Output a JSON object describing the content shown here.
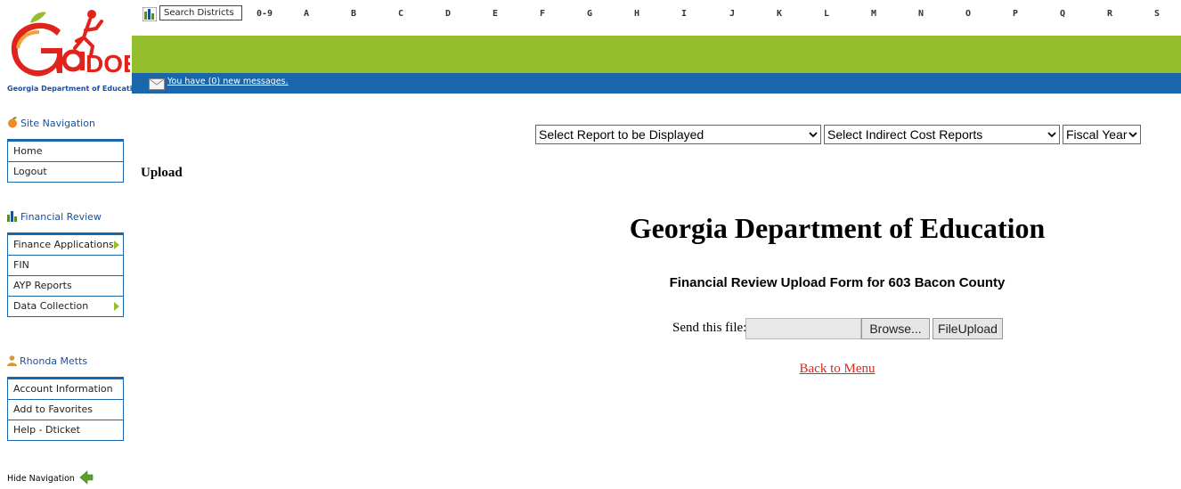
{
  "logo": {
    "caption": "Georgia Department of Education",
    "wordmark": "GaDOE",
    "colors": {
      "red": "#e0241c",
      "green": "#95be2f",
      "blue": "#1a4fa0"
    }
  },
  "topbar": {
    "search_placeholder": "Search Districts",
    "letters": [
      "0-9",
      "A",
      "B",
      "C",
      "D",
      "E",
      "F",
      "G",
      "H",
      "I",
      "J",
      "K",
      "L",
      "M",
      "N",
      "O",
      "P",
      "Q",
      "R",
      "S"
    ]
  },
  "messages": {
    "text": "You have (0) new messages."
  },
  "sidebar": {
    "site_nav": {
      "heading": "Site Navigation",
      "items": [
        {
          "label": "Home"
        },
        {
          "label": "Logout"
        }
      ]
    },
    "financial": {
      "heading": "Financial Review",
      "items": [
        {
          "label": "Finance Applications",
          "has_submenu": true
        },
        {
          "label": "FIN",
          "has_submenu": false
        },
        {
          "label": "AYP Reports",
          "has_submenu": false
        },
        {
          "label": "Data Collection",
          "has_submenu": true
        }
      ]
    },
    "user": {
      "heading": "Rhonda Metts",
      "items": [
        {
          "label": "Account Information"
        },
        {
          "label": "Add to Favorites"
        },
        {
          "label": "Help - Dticket"
        }
      ]
    },
    "hide_nav": "Hide Navigation"
  },
  "main": {
    "report_select": "Select Report to be Displayed",
    "indirect_select": "Select Indirect Cost Reports",
    "fiscal_select": "Fiscal Year",
    "upload_label": "Upload",
    "title": "Georgia Department of Education",
    "subtitle": "Financial Review Upload Form for 603 Bacon County",
    "send_label": "Send this file:",
    "browse_button": "Browse...",
    "upload_button": "FileUpload",
    "back_link": "Back to Menu"
  }
}
